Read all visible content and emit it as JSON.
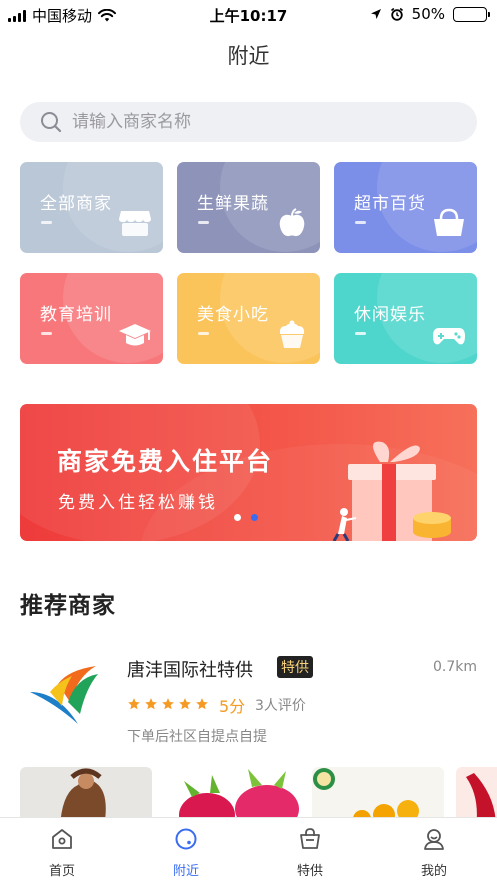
{
  "status_bar": {
    "carrier": "中国移动",
    "time": "上午10:17",
    "battery": "50%",
    "battery_level": 0.5
  },
  "header": {
    "title": "附近"
  },
  "search": {
    "placeholder": "请输入商家名称",
    "value": ""
  },
  "categories": [
    {
      "label": "全部商家",
      "color": "#b9c7d7",
      "icon": "store-icon"
    },
    {
      "label": "生鲜果蔬",
      "color": "#8d93b9",
      "icon": "apple-icon"
    },
    {
      "label": "超市百货",
      "color": "#7b8ee8",
      "icon": "basket-icon"
    },
    {
      "label": "教育培训",
      "color": "#f7777b",
      "icon": "graduation-cap-icon"
    },
    {
      "label": "美食小吃",
      "color": "#fbc45b",
      "icon": "cupcake-icon"
    },
    {
      "label": "休闲娱乐",
      "color": "#4fd6cc",
      "icon": "gamepad-icon"
    }
  ],
  "banner": {
    "title": "商家免费入住平台",
    "subtitle": "免费入住轻松赚钱",
    "active_slide": 2,
    "slide_count": 2
  },
  "recommend": {
    "title": "推荐商家",
    "merchant": {
      "name": "唐沣国际社特供",
      "badge": "特供",
      "distance": "0.7km",
      "stars": 5,
      "score": "5分",
      "reviews": "3人评价",
      "description": "下单后社区自提点自提"
    }
  },
  "tabbar": {
    "items": [
      {
        "label": "首页",
        "icon": "home-icon"
      },
      {
        "label": "附近",
        "icon": "nearby-icon"
      },
      {
        "label": "特供",
        "icon": "shopping-bag-icon"
      },
      {
        "label": "我的",
        "icon": "profile-icon"
      }
    ],
    "active_index": 1
  },
  "colors": {
    "accent": "#3a6cf0",
    "star": "#f59a23",
    "banner": "#ef4444"
  }
}
